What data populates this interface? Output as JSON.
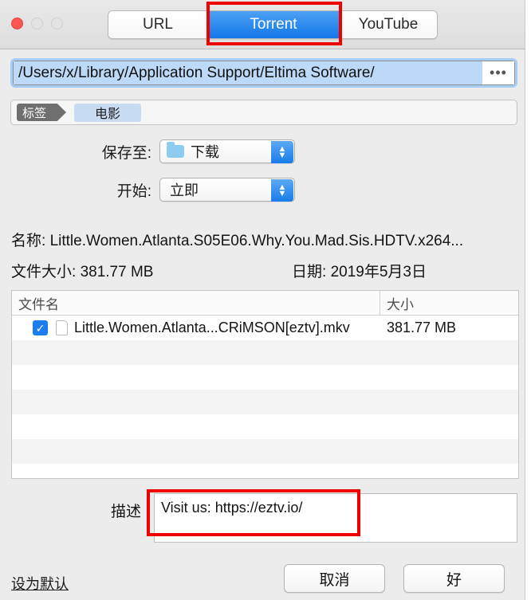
{
  "window": {
    "traffic_lights": [
      "close",
      "minimize",
      "maximize"
    ]
  },
  "tabs": [
    {
      "label": "URL",
      "active": false
    },
    {
      "label": "Torrent",
      "active": true
    },
    {
      "label": "YouTube",
      "active": false
    }
  ],
  "path_field": {
    "value": "/Users/x/Library/Application Support/Eltima Software/",
    "more_button": "•••"
  },
  "tag_bar": {
    "badge": "标签",
    "chip": "电影"
  },
  "form": {
    "save_to": {
      "label": "保存至:",
      "value": "下载",
      "icon": "folder-icon"
    },
    "start": {
      "label": "开始:",
      "value": "立即"
    }
  },
  "info": {
    "name_label": "名称:",
    "name_value": "Little.Women.Atlanta.S05E06.Why.You.Mad.Sis.HDTV.x264...",
    "size_label": "文件大小:",
    "size_value": "381.77 MB",
    "date_label": "日期:",
    "date_value": "2019年5月3日"
  },
  "file_table": {
    "columns": [
      "文件名",
      "大小"
    ],
    "rows": [
      {
        "checked": true,
        "name": "Little.Women.Atlanta...CRiMSON[eztv].mkv",
        "size": "381.77 MB"
      }
    ],
    "empty_row_count": 6
  },
  "description": {
    "label": "描述",
    "value": "Visit us: https://eztv.io/"
  },
  "footer": {
    "set_default": "设为默认",
    "cancel": "取消",
    "ok": "好"
  },
  "annotations": [
    {
      "name": "torrent-tab-highlight",
      "color": "#ee0000"
    },
    {
      "name": "description-highlight",
      "color": "#ee0000"
    }
  ],
  "colors": {
    "accent_blue": "#1277e8",
    "annotation_red": "#ee0000",
    "window_bg": "#ececec",
    "selection_blue": "#bcd9f7"
  }
}
